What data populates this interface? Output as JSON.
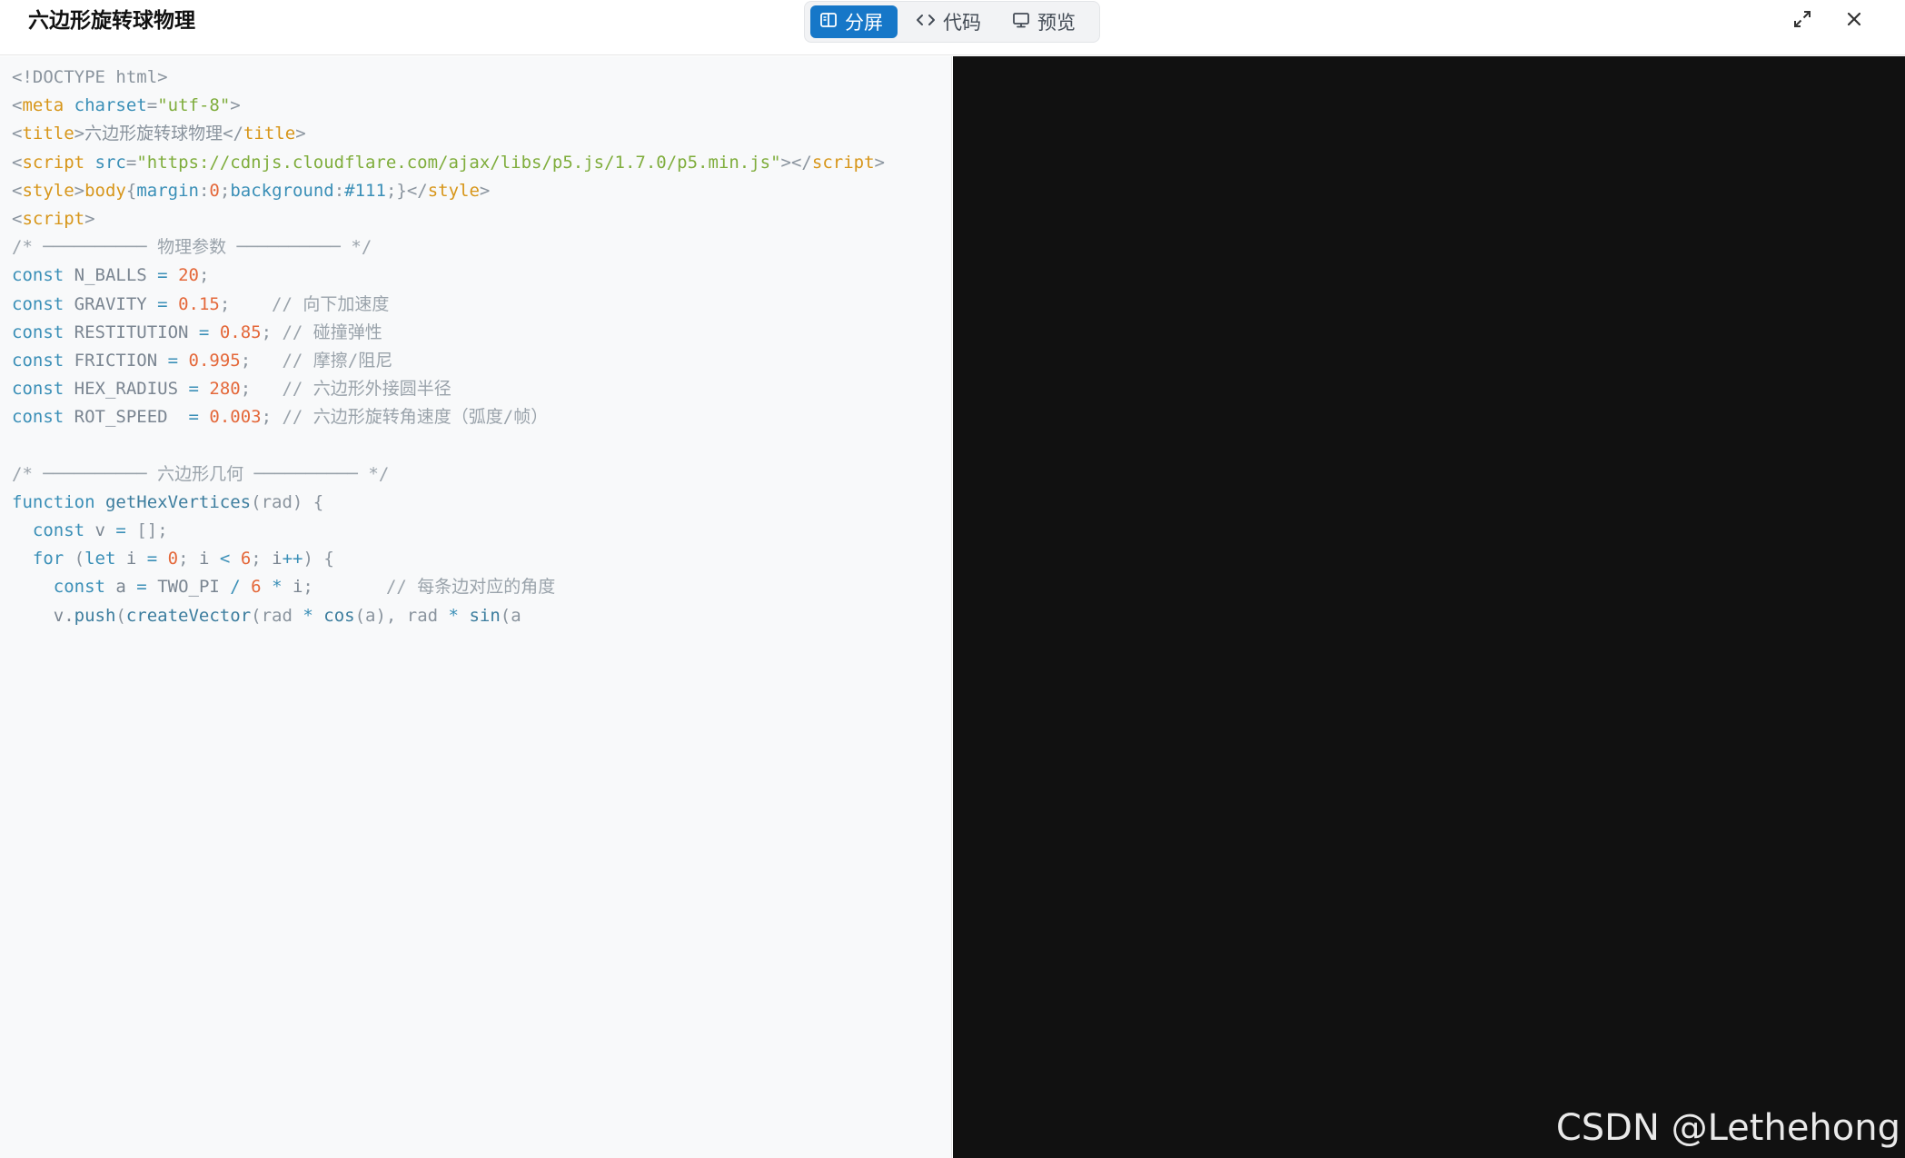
{
  "window": {
    "title": "六边形旋转球物理"
  },
  "view_toggle": {
    "split_label": "分屏",
    "code_label": "代码",
    "preview_label": "预览",
    "active": "split",
    "active_color": "#1677c8"
  },
  "actions": {
    "expand_icon": "expand-icon",
    "close_icon": "close-icon"
  },
  "code_lines": [
    [
      [
        "gray",
        "<!DOCTYPE html>"
      ]
    ],
    [
      [
        "gray",
        "<"
      ],
      [
        "tag",
        "meta"
      ],
      [
        "gray",
        " "
      ],
      [
        "attr",
        "charset"
      ],
      [
        "gray",
        "="
      ],
      [
        "str",
        "\"utf-8\""
      ],
      [
        "gray",
        ">"
      ]
    ],
    [
      [
        "gray",
        "<"
      ],
      [
        "tag",
        "title"
      ],
      [
        "gray",
        ">六边形旋转球物理</"
      ],
      [
        "tag",
        "title"
      ],
      [
        "gray",
        ">"
      ]
    ],
    [
      [
        "gray",
        "<"
      ],
      [
        "tag",
        "script"
      ],
      [
        "gray",
        " "
      ],
      [
        "attr",
        "src"
      ],
      [
        "gray",
        "="
      ],
      [
        "str",
        "\"https://cdnjs.cloudflare.com/ajax/libs/p5.js/1.7.0/p5.min.js\""
      ],
      [
        "gray",
        "></"
      ],
      [
        "tag",
        "script"
      ],
      [
        "gray",
        ">"
      ]
    ],
    [
      [
        "gray",
        "<"
      ],
      [
        "tag",
        "style"
      ],
      [
        "gray",
        ">"
      ],
      [
        "tag",
        "body"
      ],
      [
        "gray",
        "{"
      ],
      [
        "cssv",
        "margin"
      ],
      [
        "gray",
        ":"
      ],
      [
        "num",
        "0"
      ],
      [
        "gray",
        ";"
      ],
      [
        "cssv",
        "background"
      ],
      [
        "gray",
        ":"
      ],
      [
        "cssv",
        "#111"
      ],
      [
        "gray",
        ";}</"
      ],
      [
        "tag",
        "style"
      ],
      [
        "gray",
        ">"
      ]
    ],
    [
      [
        "gray",
        "<"
      ],
      [
        "tag",
        "script"
      ],
      [
        "gray",
        ">"
      ]
    ],
    [
      [
        "cmt",
        "/* ────────── 物理参数 ────────── */"
      ]
    ],
    [
      [
        "kw",
        "const"
      ],
      [
        "id",
        " N_BALLS "
      ],
      [
        "op",
        "="
      ],
      [
        "id",
        " "
      ],
      [
        "num",
        "20"
      ],
      [
        "gray",
        ";"
      ]
    ],
    [
      [
        "kw",
        "const"
      ],
      [
        "id",
        " GRAVITY "
      ],
      [
        "op",
        "="
      ],
      [
        "id",
        " "
      ],
      [
        "num",
        "0.15"
      ],
      [
        "gray",
        ";"
      ],
      [
        "cmt",
        "    // 向下加速度"
      ]
    ],
    [
      [
        "kw",
        "const"
      ],
      [
        "id",
        " RESTITUTION "
      ],
      [
        "op",
        "="
      ],
      [
        "id",
        " "
      ],
      [
        "num",
        "0.85"
      ],
      [
        "gray",
        ";"
      ],
      [
        "cmt",
        " // 碰撞弹性"
      ]
    ],
    [
      [
        "kw",
        "const"
      ],
      [
        "id",
        " FRICTION "
      ],
      [
        "op",
        "="
      ],
      [
        "id",
        " "
      ],
      [
        "num",
        "0.995"
      ],
      [
        "gray",
        ";"
      ],
      [
        "cmt",
        "   // 摩擦/阻尼"
      ]
    ],
    [
      [
        "kw",
        "const"
      ],
      [
        "id",
        " HEX_RADIUS "
      ],
      [
        "op",
        "="
      ],
      [
        "id",
        " "
      ],
      [
        "num",
        "280"
      ],
      [
        "gray",
        ";"
      ],
      [
        "cmt",
        "   // 六边形外接圆半径"
      ]
    ],
    [
      [
        "kw",
        "const"
      ],
      [
        "id",
        " ROT_SPEED  "
      ],
      [
        "op",
        "="
      ],
      [
        "id",
        " "
      ],
      [
        "num",
        "0.003"
      ],
      [
        "gray",
        ";"
      ],
      [
        "cmt",
        " // 六边形旋转角速度（弧度/帧）"
      ]
    ],
    [],
    [
      [
        "cmt",
        "/* ────────── 六边形几何 ────────── */"
      ]
    ],
    [
      [
        "kw",
        "function"
      ],
      [
        "id",
        " "
      ],
      [
        "fn",
        "getHexVertices"
      ],
      [
        "gray",
        "(rad) {"
      ]
    ],
    [
      [
        "id",
        "  "
      ],
      [
        "kw",
        "const"
      ],
      [
        "id",
        " v "
      ],
      [
        "op",
        "="
      ],
      [
        "gray",
        " [];"
      ]
    ],
    [
      [
        "id",
        "  "
      ],
      [
        "kw",
        "for"
      ],
      [
        "gray",
        " ("
      ],
      [
        "kw",
        "let"
      ],
      [
        "id",
        " i "
      ],
      [
        "op",
        "="
      ],
      [
        "id",
        " "
      ],
      [
        "num",
        "0"
      ],
      [
        "gray",
        ";"
      ],
      [
        "id",
        " i "
      ],
      [
        "op",
        "<"
      ],
      [
        "id",
        " "
      ],
      [
        "num",
        "6"
      ],
      [
        "gray",
        ";"
      ],
      [
        "id",
        " i"
      ],
      [
        "op",
        "++"
      ],
      [
        "gray",
        ") {"
      ]
    ],
    [
      [
        "id",
        "    "
      ],
      [
        "kw",
        "const"
      ],
      [
        "id",
        " a "
      ],
      [
        "op",
        "="
      ],
      [
        "id",
        " TWO_PI "
      ],
      [
        "op",
        "/"
      ],
      [
        "id",
        " "
      ],
      [
        "num",
        "6"
      ],
      [
        "id",
        " "
      ],
      [
        "op",
        "*"
      ],
      [
        "id",
        " i"
      ],
      [
        "gray",
        ";"
      ],
      [
        "cmt",
        "       // 每条边对应的角度"
      ]
    ],
    [
      [
        "id",
        "    v."
      ],
      [
        "fn",
        "push"
      ],
      [
        "gray",
        "("
      ],
      [
        "fn",
        "createVector"
      ],
      [
        "gray",
        "(rad "
      ],
      [
        "op",
        "*"
      ],
      [
        "id",
        " "
      ],
      [
        "fn",
        "cos"
      ],
      [
        "gray",
        "(a), rad "
      ],
      [
        "op",
        "*"
      ],
      [
        "id",
        " "
      ],
      [
        "fn",
        "sin"
      ],
      [
        "gray",
        "(a"
      ]
    ]
  ],
  "preview": {
    "background": "#111111",
    "watermark": "CSDN @Lethehong"
  }
}
